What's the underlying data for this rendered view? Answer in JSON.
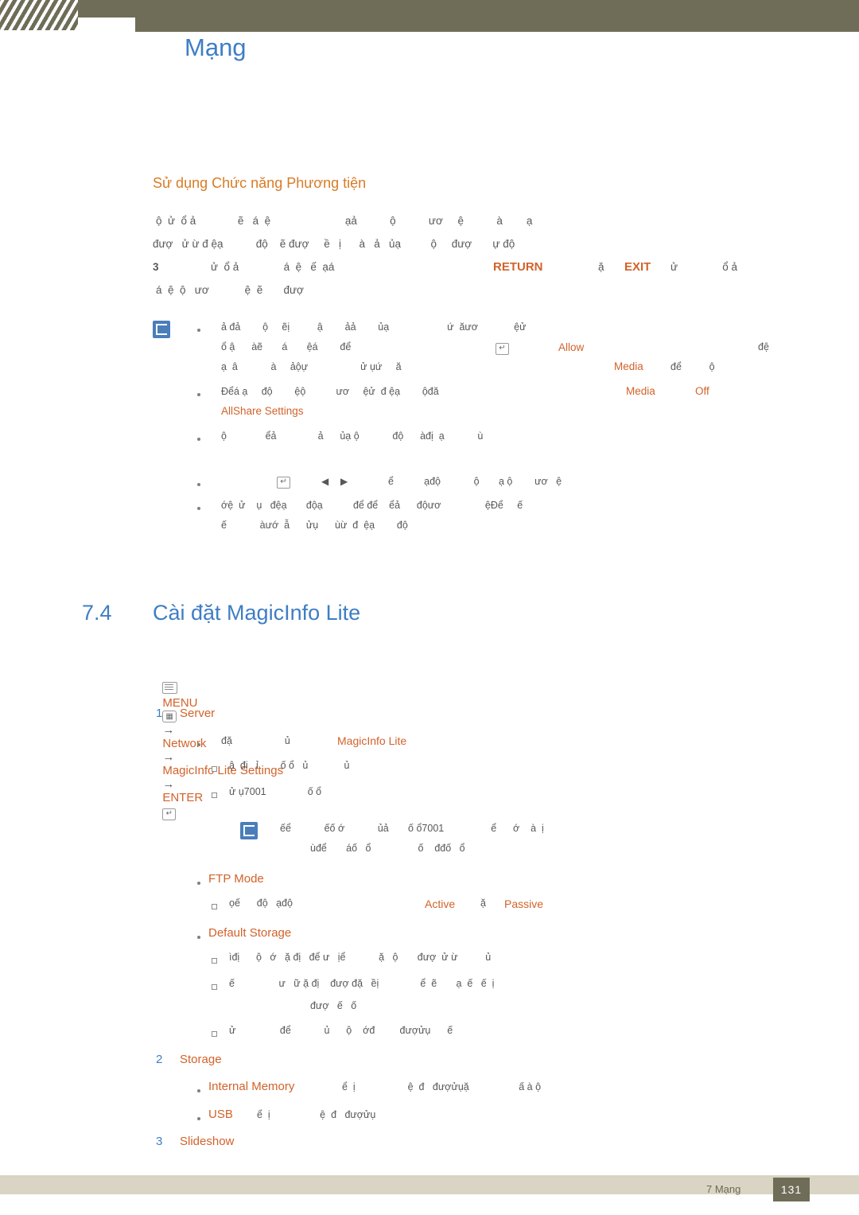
{
  "header": {
    "chapter_title": "Mạng"
  },
  "section": {
    "heading": "Sử dụng Chức năng Phương tiện"
  },
  "intro": {
    "line1": "ộ  ử  ổ ả              ẽ   á  ệ                         ạả           ộ           ươ     ệ           à        ạ",
    "line2": "đượ   ử ừ đ ệạ           độ    ẽ đượ     ề   ị      à   ả   ủạ          ộ     đượ       ự độ",
    "line3_num": "3",
    "line3": "ử  ổ ả               á  ệ   ế  ạá",
    "line3_return": "RETURN",
    "line3_mid": "ặ",
    "line3_exit": "EXIT",
    "line3_tail": "ử               ổ ả",
    "line4": "á  ệ  ộ   ươ            ệ  ẽ       đượ"
  },
  "notes": [
    {
      "l1": "ả đả        ộ     ẽị          ậ        ảả        ủạ                     ứ  ăươ             ệử",
      "l2": "ổ ậ      àẽ       á       ệá        để",
      "l2_allow": "Allow",
      "l2_tail": "đệ",
      "l3": "ạ  â            à     ảộự                   ử ụứ     ă",
      "l3_media": "Media",
      "l3_tail": "để          ộ"
    },
    {
      "l1": "Đểá ạ     độ        ệộ           ươ     ệử  đ ệạ        ộđă",
      "l1_media": "Media",
      "l1_off": "Off",
      "l2_allshare": "AllShare Settings"
    },
    {
      "l1": "ộ              ểả               ả      ủạ ộ            độ      àđị  ạ            ù"
    },
    {
      "l1": "ể           ạđộ            ộ       ạ ộ        ươ   ệ"
    },
    {
      "l1": "ớệ  ử    ụ   đệạ       độạ           để để    ểả      độươ                ệĐể     ế",
      "l2": "ế            àướ  ẫ      ửụ      ùừ  đ  ệạ        độ"
    }
  ],
  "section74": {
    "number": "7.4",
    "title": "Cài đặt MagicInfo Lite"
  },
  "menu_path": {
    "menu": "MENU",
    "arrow1": "→",
    "network": "Network",
    "arrow2": "→",
    "settings": "MagicInfo Lite Settings",
    "arrow3": "→",
    "enter": "ENTER"
  },
  "items": [
    {
      "num": "1",
      "label": "Server",
      "bullets": [
        {
          "text": "đặ                   ủ ",
          "link": "MagicInfo Lite",
          "subs": [
            "ậ  đị   ỉ        ố ổ   ủ             ủ",
            "ử ụ7001               ố ổ"
          ],
          "note": {
            "l1": "ếể            ếố ớ            ủả       ố ổ7001                 ể      ớ    à  ị",
            "l2": "ùđể       áố   ổ                 ố    đđố   ổ"
          }
        },
        {
          "text_orange": "FTP Mode",
          "subs_rich": [
            {
              "pre": "ọế      độ   ạđộ",
              "val1": "Active",
              "mid": "ặ",
              "val2": "Passive"
            }
          ]
        },
        {
          "text_orange": "Default Storage",
          "subs": [
            "ìđị      ộ   ớ   ặ đị   để ư   ịể            ặ   ộ       đượ  ử ừ          ủ",
            "ế                ư   ữ ặ đị    đượ đặ   ềị               ể  ẽ       ạ  ế   ế  ị",
            "đượ   ế   ố",
            "ử                để            ủ      ộ    ớđ         đượửụ      ế"
          ]
        }
      ]
    },
    {
      "num": "2",
      "label": "Storage",
      "bullets": [
        {
          "text_orange": "Internal Memory",
          "tail": "ể  ị                   ệ  đ   đượửụặ                  ấ à ộ"
        },
        {
          "text_orange": "USB",
          "tail": "ể  ị                  ệ  đ   đượửụ"
        }
      ]
    },
    {
      "num": "3",
      "label": "Slideshow"
    }
  ],
  "footer": {
    "chapter": "7 Mạng",
    "page": "131"
  }
}
